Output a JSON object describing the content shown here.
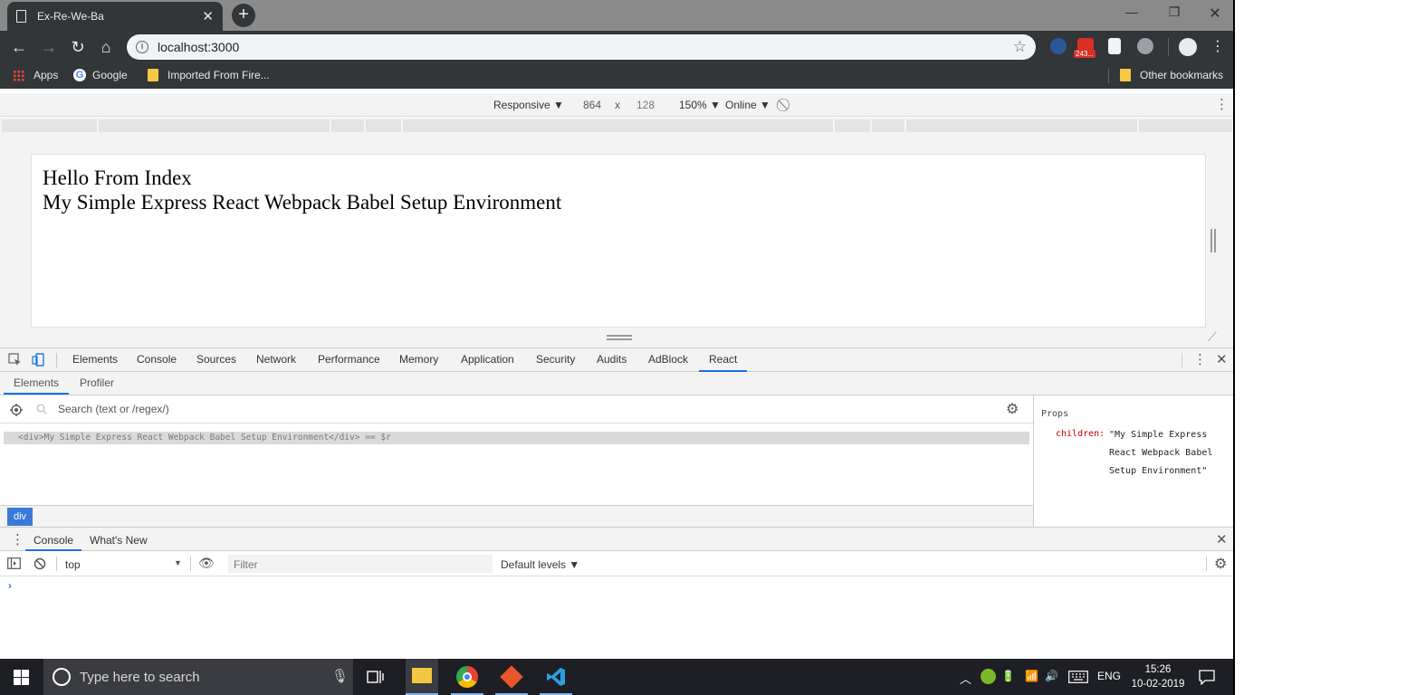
{
  "browser": {
    "tab_title": "Ex-Re-We-Ba",
    "url": "localhost:3000",
    "bookmarks": [
      {
        "label": "Apps"
      },
      {
        "label": "Google"
      },
      {
        "label": "Imported From Fire..."
      }
    ],
    "other_bookmarks": "Other bookmarks",
    "ext_badge": "243..."
  },
  "device_toolbar": {
    "mode": "Responsive ▼",
    "width": "864",
    "times": "x",
    "height": "128",
    "zoom": "150% ▼",
    "network": "Online ▼"
  },
  "page": {
    "line1": "Hello From Index",
    "line2": "My Simple Express React Webpack Babel Setup Environment"
  },
  "devtools": {
    "tabs": [
      "Elements",
      "Console",
      "Sources",
      "Network",
      "Performance",
      "Memory",
      "Application",
      "Security",
      "Audits",
      "AdBlock",
      "React"
    ],
    "react_subtabs": [
      "Elements",
      "Profiler"
    ],
    "search_placeholder": "Search (text or /regex/)",
    "tree_row": "<div>My Simple Express React Webpack Babel Setup Environment</div> == $r",
    "breadcrumb": "div",
    "props": {
      "header": "Props",
      "key": "children:",
      "value": "\"My Simple Express React Webpack Babel Setup Environment\""
    }
  },
  "drawer": {
    "tabs": [
      "Console",
      "What's New"
    ],
    "context": "top",
    "filter_placeholder": "Filter",
    "levels": "Default levels ▼",
    "prompt": "›"
  },
  "taskbar": {
    "search_placeholder": "Type here to search",
    "lang": "ENG",
    "time": "15:26",
    "date": "10-02-2019"
  },
  "colors": {
    "accent": "#1a73e8",
    "chrome_dark": "#323639",
    "taskbar": "#1d1f25",
    "breadcrumb": "#3879d9"
  }
}
